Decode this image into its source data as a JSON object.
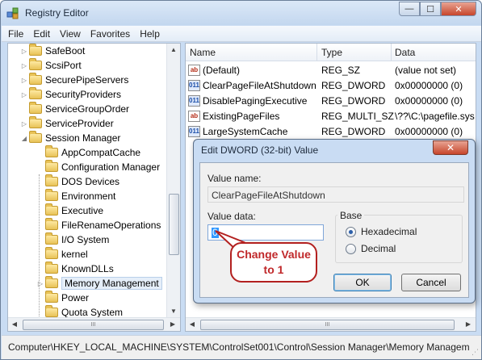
{
  "window": {
    "title": "Registry Editor",
    "controls": {
      "minimize": "—",
      "maximize": "☐",
      "close": "✕"
    }
  },
  "menu": [
    "File",
    "Edit",
    "View",
    "Favorites",
    "Help"
  ],
  "tree": {
    "items": [
      {
        "label": "SafeBoot",
        "level": 0,
        "expander": "▷"
      },
      {
        "label": "ScsiPort",
        "level": 0,
        "expander": "▷"
      },
      {
        "label": "SecurePipeServers",
        "level": 0,
        "expander": "▷"
      },
      {
        "label": "SecurityProviders",
        "level": 0,
        "expander": "▷"
      },
      {
        "label": "ServiceGroupOrder",
        "level": 0,
        "expander": ""
      },
      {
        "label": "ServiceProvider",
        "level": 0,
        "expander": "▷"
      },
      {
        "label": "Session Manager",
        "level": 0,
        "expander": "◢"
      },
      {
        "label": "AppCompatCache",
        "level": 1,
        "expander": ""
      },
      {
        "label": "Configuration Manager",
        "level": 1,
        "expander": ""
      },
      {
        "label": "DOS Devices",
        "level": 1,
        "expander": ""
      },
      {
        "label": "Environment",
        "level": 1,
        "expander": ""
      },
      {
        "label": "Executive",
        "level": 1,
        "expander": ""
      },
      {
        "label": "FileRenameOperations",
        "level": 1,
        "expander": ""
      },
      {
        "label": "I/O System",
        "level": 1,
        "expander": ""
      },
      {
        "label": "kernel",
        "level": 1,
        "expander": ""
      },
      {
        "label": "KnownDLLs",
        "level": 1,
        "expander": ""
      },
      {
        "label": "Memory Management",
        "level": 1,
        "expander": "▷",
        "selected": true
      },
      {
        "label": "Power",
        "level": 1,
        "expander": ""
      },
      {
        "label": "Quota System",
        "level": 1,
        "expander": ""
      }
    ]
  },
  "list": {
    "columns": [
      "Name",
      "Type",
      "Data"
    ],
    "rows": [
      {
        "icon": "ab",
        "name": "(Default)",
        "type": "REG_SZ",
        "data": "(value not set)"
      },
      {
        "icon": "011",
        "name": "ClearPageFileAtShutdown",
        "type": "REG_DWORD",
        "data": "0x00000000 (0)"
      },
      {
        "icon": "011",
        "name": "DisablePagingExecutive",
        "type": "REG_DWORD",
        "data": "0x00000000 (0)"
      },
      {
        "icon": "ab",
        "name": "ExistingPageFiles",
        "type": "REG_MULTI_SZ",
        "data": "\\??\\C:\\pagefile.sys"
      },
      {
        "icon": "011",
        "name": "LargeSystemCache",
        "type": "REG_DWORD",
        "data": "0x00000000 (0)"
      }
    ]
  },
  "status": {
    "path": "Computer\\HKEY_LOCAL_MACHINE\\SYSTEM\\ControlSet001\\Control\\Session Manager\\Memory Managem"
  },
  "dialog": {
    "title": "Edit DWORD (32-bit) Value",
    "close": "✕",
    "value_name_label": "Value name:",
    "value_name": "ClearPageFileAtShutdown",
    "value_data_label": "Value data:",
    "value_data": "0",
    "base_label": "Base",
    "hex_label": "Hexadecimal",
    "dec_label": "Decimal",
    "selected_base": "Hexadecimal",
    "ok_label": "OK",
    "cancel_label": "Cancel"
  },
  "annotation": {
    "line1": "Change Value",
    "line2": "to 1",
    "color": "#b3201f"
  },
  "icons": {
    "app": "registry-icon",
    "folder": "folder-icon",
    "string_value": "string-value-icon",
    "binary_value": "dword-value-icon"
  }
}
